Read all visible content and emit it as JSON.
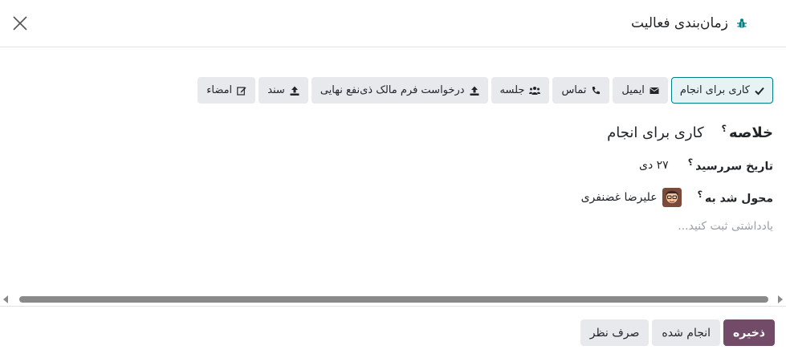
{
  "dialog": {
    "title": "زمان‌بندی فعالیت"
  },
  "activity_types": [
    {
      "label": "کاری برای انجام",
      "icon": "check-icon",
      "active": true
    },
    {
      "label": "ایمیل",
      "icon": "envelope-icon",
      "active": false
    },
    {
      "label": "تماس",
      "icon": "phone-icon",
      "active": false
    },
    {
      "label": "جلسه",
      "icon": "users-icon",
      "active": false
    },
    {
      "label": "درخواست فرم مالک ذی‌نفع نهایی",
      "icon": "upload-icon",
      "active": false
    },
    {
      "label": "سند",
      "icon": "upload-icon",
      "active": false
    },
    {
      "label": "امضاء",
      "icon": "edit-icon",
      "active": false
    }
  ],
  "form": {
    "summary_label": "خلاصه",
    "summary_value": "کاری برای انجام",
    "help_mark": "؟",
    "due_date_label": "تاریخ سررسید",
    "due_date_value": "۲۷ دی",
    "assigned_label": "محول شد به",
    "assigned_value": "علیرضا غضنفری",
    "note_placeholder": "یادداشتی ثبت کنید..."
  },
  "footer": {
    "save_label": "ذخیره",
    "done_label": "انجام شده",
    "discard_label": "صرف نظر"
  },
  "colors": {
    "primary": "#714b67",
    "active_border": "#017e84",
    "bug_icon": "#017e84"
  }
}
